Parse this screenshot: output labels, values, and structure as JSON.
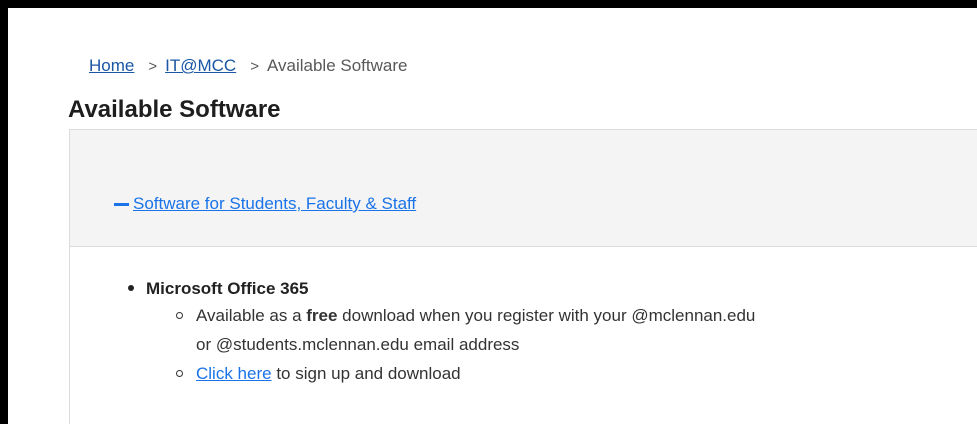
{
  "breadcrumb": {
    "home": "Home",
    "separator1": ">",
    "it_mcc": "IT@MCC",
    "separator2": ">",
    "current": "Available Software"
  },
  "page": {
    "title": "Available Software"
  },
  "accordion": {
    "toggle_label": "Software for Students, Faculty & Staff",
    "items": [
      {
        "title": "Microsoft Office 365",
        "sub": {
          "item1_prefix": "Available as a ",
          "item1_bold": "free",
          "item1_line1_suffix": " download when you register with your @mclennan.edu",
          "item1_line2": "or @students.mclennan.edu email address",
          "item2_link": "Click here",
          "item2_suffix": " to sign up and download"
        }
      }
    ]
  },
  "colors": {
    "link": "#1a73e8",
    "breadcrumb_link": "#1a56a4",
    "panel_header_bg": "#f4f4f4",
    "border": "#dcdcdc"
  }
}
